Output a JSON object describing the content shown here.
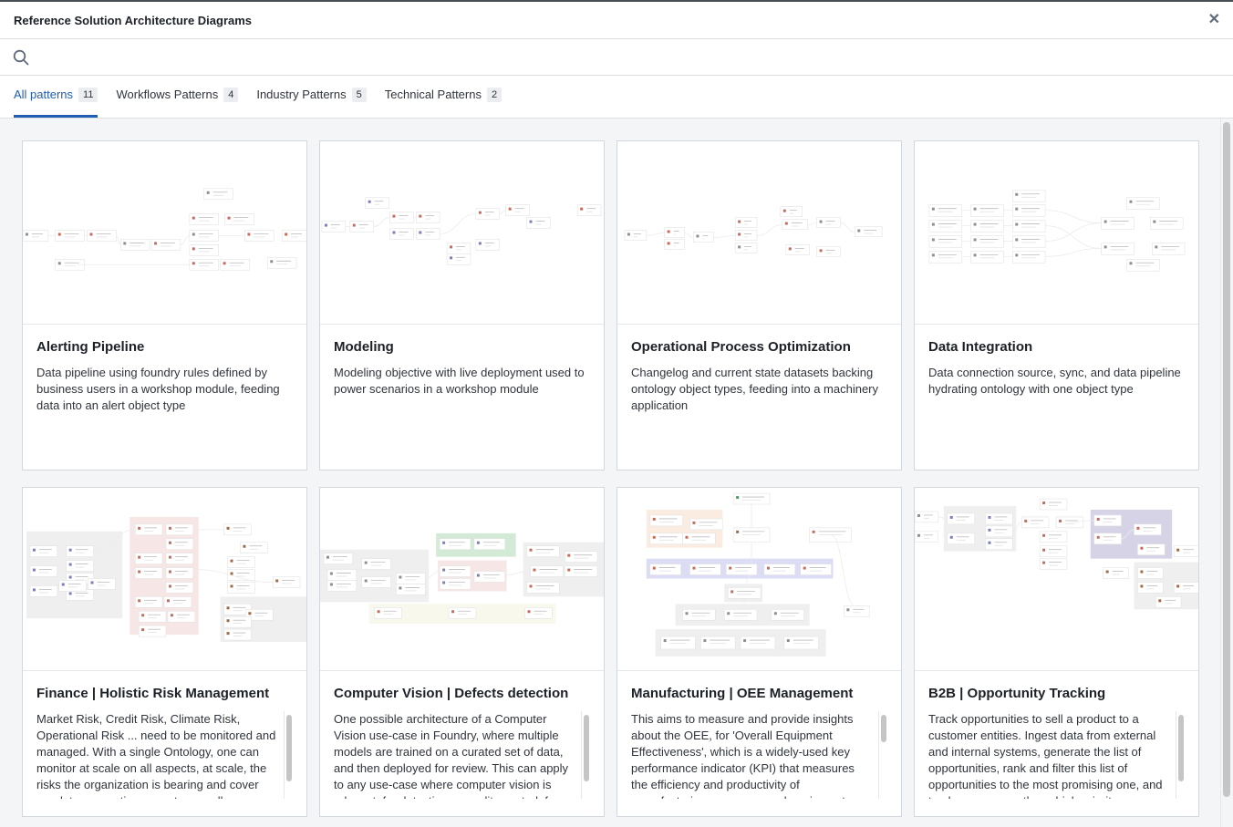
{
  "dialog": {
    "title": "Reference Solution Architecture Diagrams",
    "close_icon": "close-icon"
  },
  "search": {
    "icon": "search-icon",
    "value": "",
    "placeholder": ""
  },
  "tabs": [
    {
      "label": "All patterns",
      "count": "11",
      "active": true
    },
    {
      "label": "Workflows Patterns",
      "count": "4",
      "active": false
    },
    {
      "label": "Industry Patterns",
      "count": "5",
      "active": false
    },
    {
      "label": "Technical Patterns",
      "count": "2",
      "active": false
    }
  ],
  "cards": [
    {
      "title": "Alerting Pipeline",
      "description": "Data pipeline using foundry rules defined by business users in a workshop module, feeding data into an alert object type",
      "thumbnail": "architecture-diagram-alerting-pipeline"
    },
    {
      "title": "Modeling",
      "description": "Modeling objective with live deployment used to power scenarios in a workshop module",
      "thumbnail": "architecture-diagram-modeling"
    },
    {
      "title": "Operational Process Optimization",
      "description": "Changelog and current state datasets backing ontology object types, feeding into a machinery application",
      "thumbnail": "architecture-diagram-operational-process"
    },
    {
      "title": "Data Integration",
      "description": "Data connection source, sync, and data pipeline hydrating ontology with one object type",
      "thumbnail": "architecture-diagram-data-integration"
    },
    {
      "title": "Finance | Holistic Risk Management",
      "description": "Market Risk, Credit Risk, Climate Risk, Operational Risk ... need to be monitored and managed. With a single Ontology, one can monitor at scale on all aspects, at scale, the risks the organization is bearing and cover regulatory reporting aspects as well as",
      "thumbnail": "architecture-diagram-finance-risk"
    },
    {
      "title": "Computer Vision | Defects detection",
      "description": "One possible architecture of a Computer Vision use-case in Foundry, where multiple models are trained on a curated set of data, and then deployed for review. This can apply to any use-case where computer vision is relevant, for detection or quality control, for",
      "thumbnail": "architecture-diagram-computer-vision"
    },
    {
      "title": "Manufacturing | OEE Management",
      "description": "This aims to measure and provide insights about the OEE, for 'Overall Equipment Effectiveness', which is a widely-used key performance indicator (KPI) that measures the efficiency and productivity of manufacturing processes and equipment",
      "thumbnail": "architecture-diagram-oee"
    },
    {
      "title": "B2B | Opportunity Tracking",
      "description": "Track opportunities to sell a product to a customer entities. Ingest data from external and internal systems, generate the list of opportunities, rank and filter this list of opportunities to the most promising one, and track progress on those high-priority",
      "thumbnail": "architecture-diagram-b2b"
    }
  ],
  "colors": {
    "accent": "#215db0",
    "group_red": "#f7e6e6",
    "group_green": "#d3ebd6",
    "group_purple": "#dcdcf5",
    "group_orange": "#fbece1",
    "group_gray": "#efefef",
    "group_yellow": "#f8f8ec",
    "group_lavender": "#d6d3e6"
  }
}
